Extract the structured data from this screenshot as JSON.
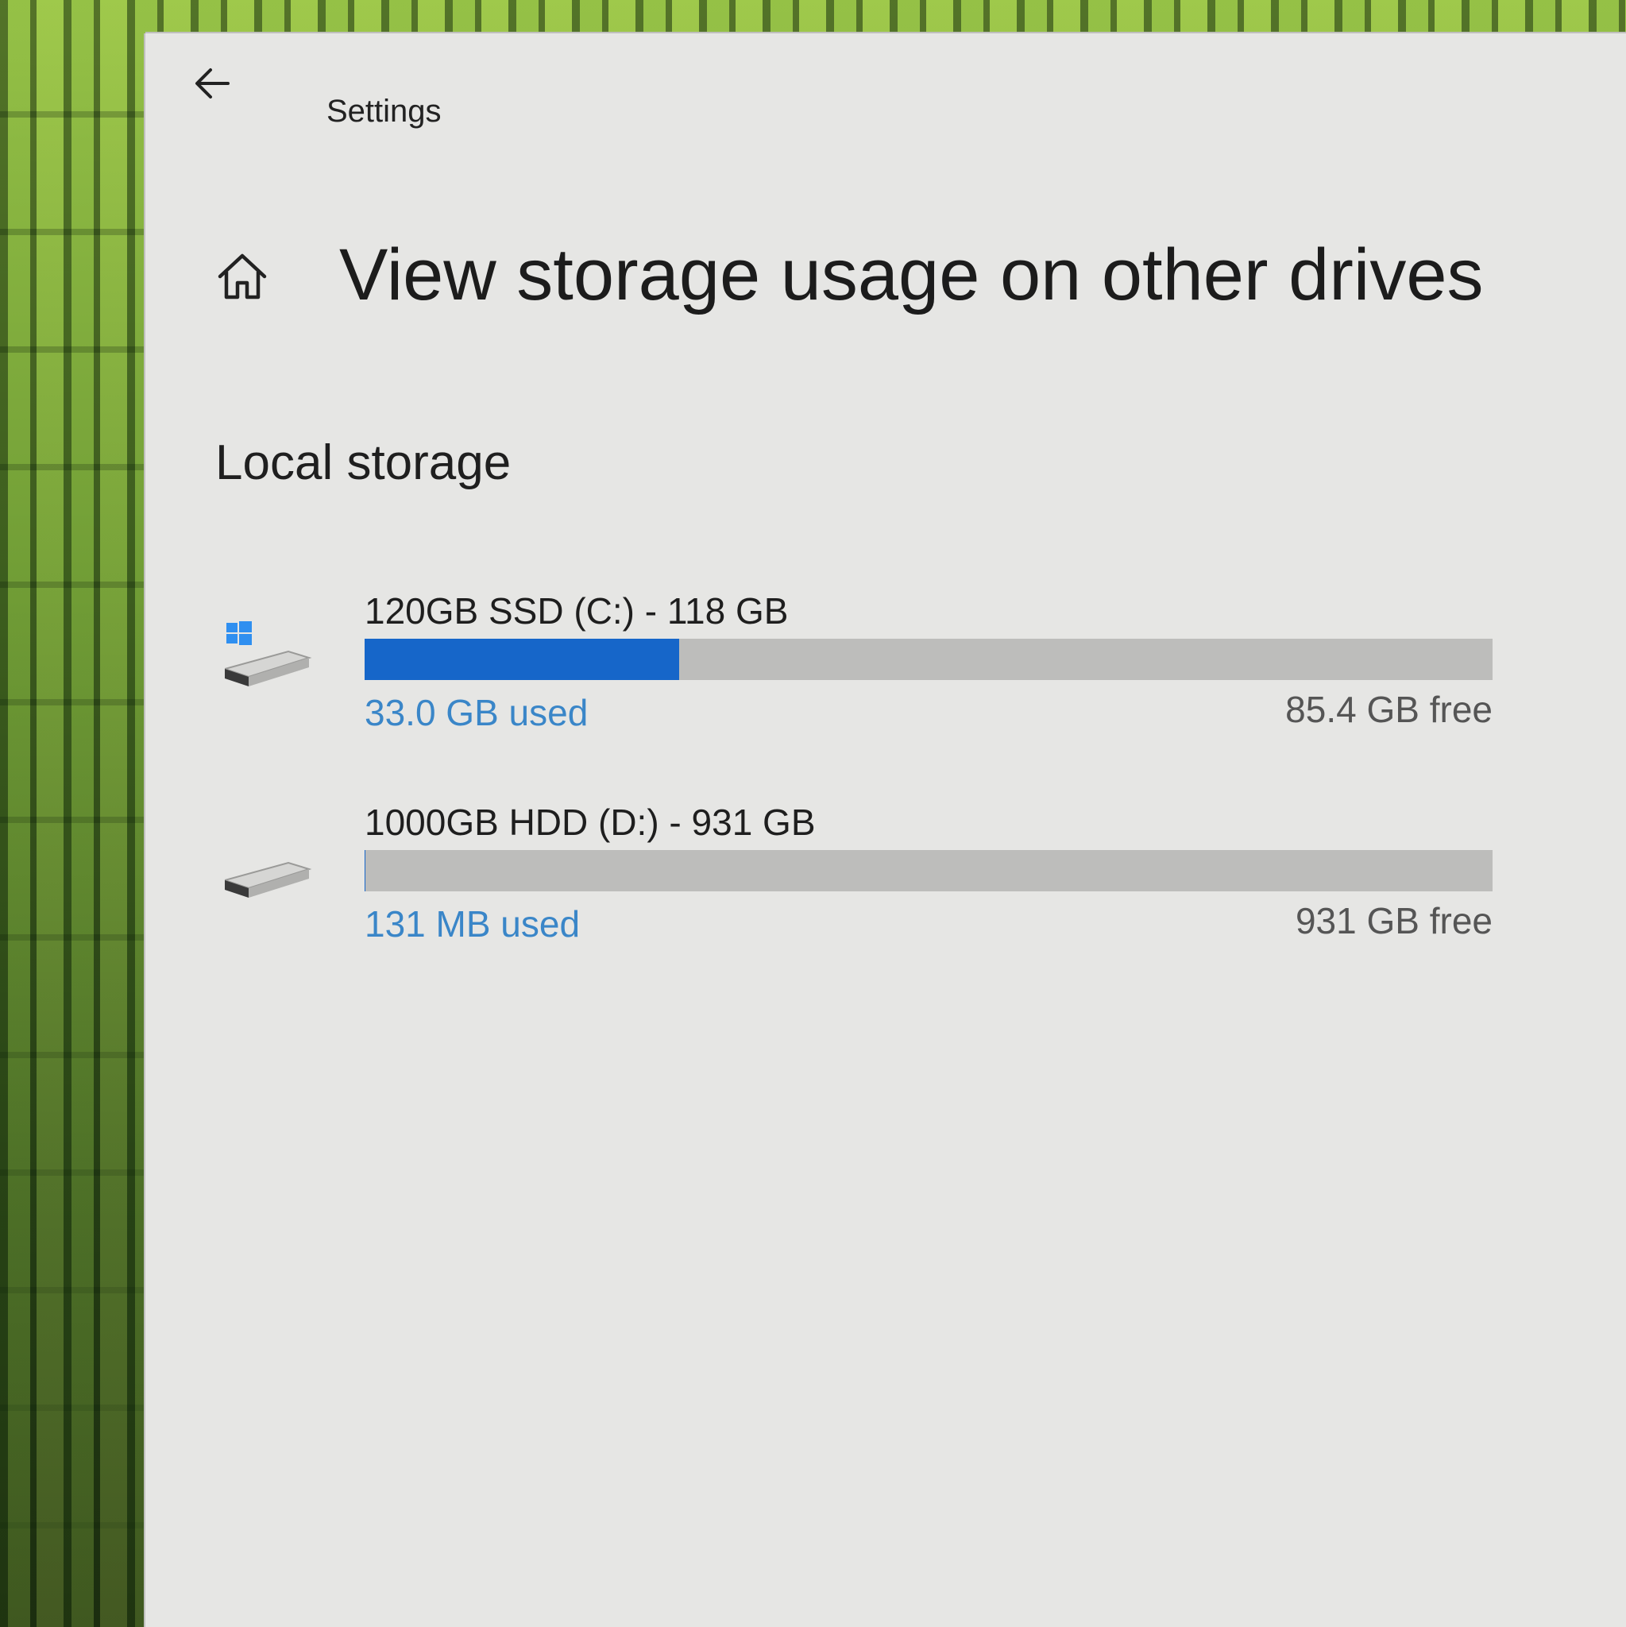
{
  "window": {
    "app_title": "Settings",
    "page_title": "View storage usage on other drives"
  },
  "section": {
    "title": "Local storage"
  },
  "drives": [
    {
      "name": "120GB SSD (C:) - 118 GB",
      "used": "33.0 GB used",
      "free": "85.4 GB free",
      "used_fraction": 0.279,
      "icon": "system-drive-icon"
    },
    {
      "name": "1000GB HDD (D:) - 931 GB",
      "used": "131 MB used",
      "free": "931 GB free",
      "used_fraction": 0.0001,
      "icon": "hard-drive-icon"
    }
  ],
  "colors": {
    "accent": "#1666c9",
    "used_text": "#3a86c8",
    "track": "#bdbdbb",
    "window_bg": "#e6e6e4"
  }
}
